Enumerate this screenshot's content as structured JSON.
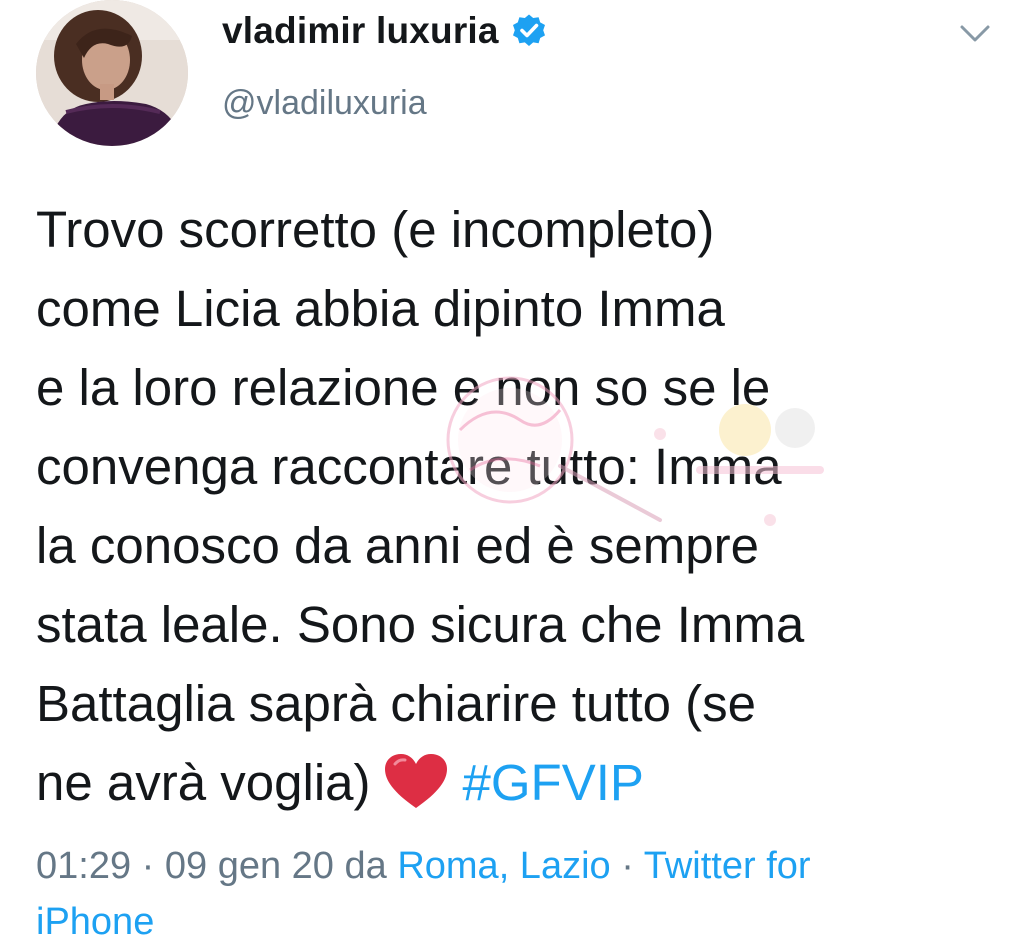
{
  "author": {
    "display_name": "vladimir luxuria",
    "handle": "@vladiluxuria",
    "verified": true
  },
  "tweet": {
    "lines": [
      "Trovo scorretto (e incompleto)",
      "come Licia abbia dipinto Imma",
      "e la loro relazione e non so se le",
      "convenga raccontare tutto: Imma",
      "la conosco da anni ed è sempre",
      "stata leale. Sono sicura che Imma",
      "Battaglia saprà chiarire tutto (se"
    ],
    "last_line_text": "ne avrà voglia)",
    "emoji": "heart-icon",
    "hashtag": "#GFVIP"
  },
  "meta": {
    "time": "01:29",
    "sep1": " · ",
    "date": "09 gen 20",
    "da": " da ",
    "location": "Roma, Lazio",
    "sep2": " · ",
    "source_line1": "Twitter for",
    "source_line2": "iPhone"
  },
  "colors": {
    "text": "#14171a",
    "secondary": "#657786",
    "link": "#1da1f2",
    "heart": "#e0245e"
  }
}
